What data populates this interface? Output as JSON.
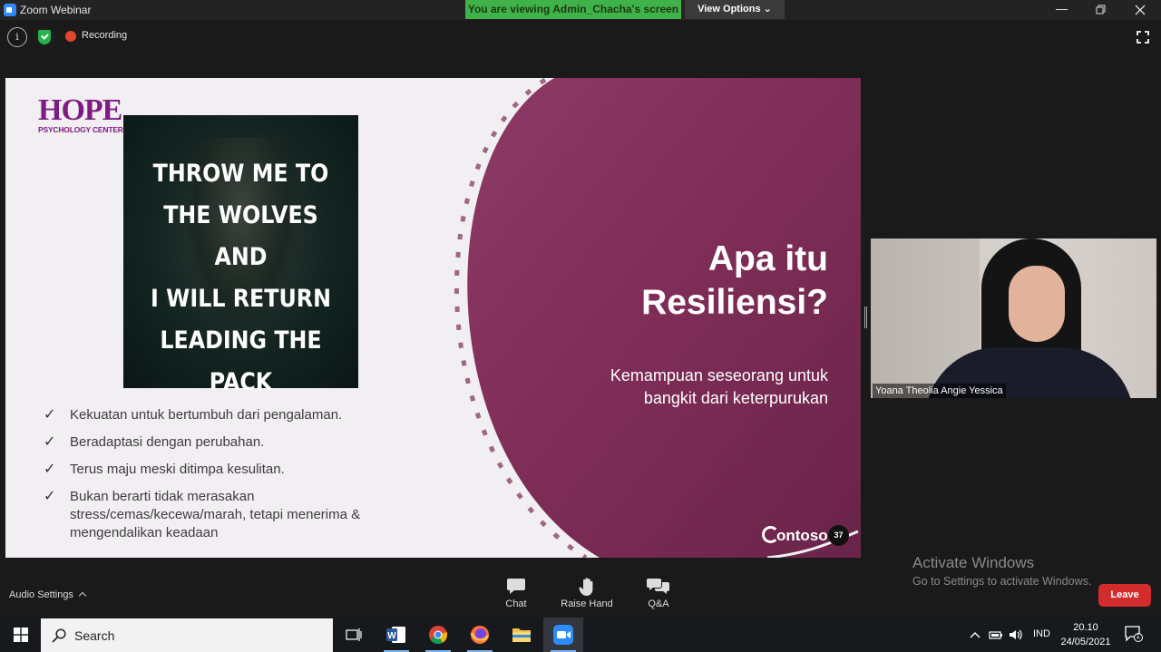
{
  "window": {
    "title": "Zoom Webinar",
    "banner": "You are viewing Admin_Chacha's screen",
    "view_options": "View Options"
  },
  "meeting_top": {
    "recording_label": "Recording"
  },
  "slide": {
    "logo_main": "HOPE",
    "logo_sub": "PSYCHOLOGY CENTER",
    "poster_lines": [
      "THROW ME TO",
      "THE WOLVES AND",
      "I WILL RETURN",
      "LEADING THE",
      "PACK"
    ],
    "bullets": [
      "Kekuatan untuk bertumbuh dari pengalaman.",
      "Beradaptasi dengan perubahan.",
      "Terus maju meski ditimpa kesulitan.",
      "Bukan berarti tidak merasakan stress/cemas/kecewa/marah, tetapi menerima & mengendalikan keadaan"
    ],
    "title_line1": "Apa itu",
    "title_line2": "Resiliensi?",
    "subtitle_line1": "Kemampuan seseorang untuk",
    "subtitle_line2": "bangkit dari keterpurukan",
    "brand": "ontoso",
    "page_number": "37",
    "accent_color": "#8e3a66"
  },
  "video": {
    "participant_name": "Yoana Theolia Angie Yessica"
  },
  "watermark": {
    "line1": "Activate Windows",
    "line2": "Go to Settings to activate Windows."
  },
  "bottom_bar": {
    "audio_settings": "Audio Settings",
    "chat": "Chat",
    "raise_hand": "Raise Hand",
    "qa": "Q&A",
    "leave": "Leave",
    "leave_color": "#d32c2c"
  },
  "taskbar": {
    "search_label": "Search",
    "language": "IND",
    "time": "20.10",
    "date": "24/05/2021",
    "notification_count": "1"
  }
}
